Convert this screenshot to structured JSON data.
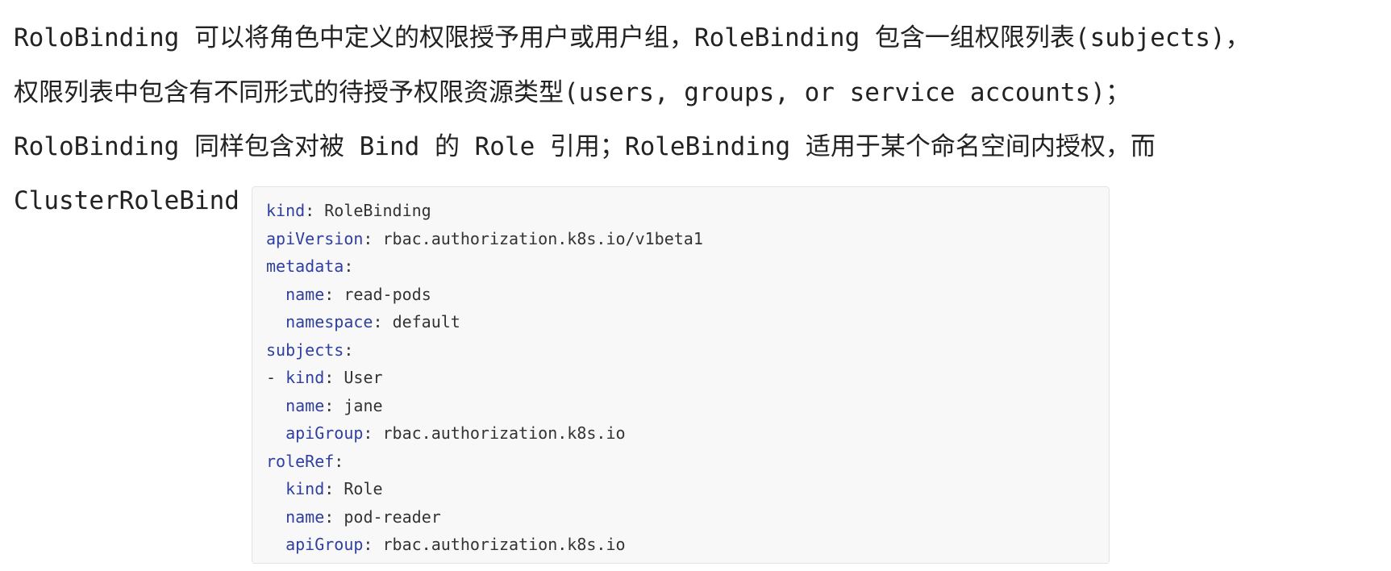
{
  "paragraph": {
    "line1": "RoloBinding 可以将角色中定义的权限授予用户或用户组，RoleBinding 包含一组权限列表(subjects)，",
    "line2": "权限列表中包含有不同形式的待授予权限资源类型(users, groups, or service accounts)；",
    "line3": "RoloBinding 同样包含对被 Bind 的 Role 引用；RoleBinding 适用于某个命名空间内授权，而",
    "line4": "ClusterRoleBind"
  },
  "code": {
    "lines": [
      {
        "indent": "",
        "prefix": "",
        "key": "kind",
        "sep": ": ",
        "value": "RoleBinding"
      },
      {
        "indent": "",
        "prefix": "",
        "key": "apiVersion",
        "sep": ": ",
        "value": "rbac.authorization.k8s.io/v1beta1"
      },
      {
        "indent": "",
        "prefix": "",
        "key": "metadata",
        "sep": ":",
        "value": ""
      },
      {
        "indent": "  ",
        "prefix": "",
        "key": "name",
        "sep": ": ",
        "value": "read-pods"
      },
      {
        "indent": "  ",
        "prefix": "",
        "key": "namespace",
        "sep": ": ",
        "value": "default"
      },
      {
        "indent": "",
        "prefix": "",
        "key": "subjects",
        "sep": ":",
        "value": ""
      },
      {
        "indent": "",
        "prefix": "- ",
        "key": "kind",
        "sep": ": ",
        "value": "User"
      },
      {
        "indent": "  ",
        "prefix": "",
        "key": "name",
        "sep": ": ",
        "value": "jane"
      },
      {
        "indent": "  ",
        "prefix": "",
        "key": "apiGroup",
        "sep": ": ",
        "value": "rbac.authorization.k8s.io"
      },
      {
        "indent": "",
        "prefix": "",
        "key": "roleRef",
        "sep": ":",
        "value": ""
      },
      {
        "indent": "  ",
        "prefix": "",
        "key": "kind",
        "sep": ": ",
        "value": "Role"
      },
      {
        "indent": "  ",
        "prefix": "",
        "key": "name",
        "sep": ": ",
        "value": "pod-reader"
      },
      {
        "indent": "  ",
        "prefix": "",
        "key": "apiGroup",
        "sep": ": ",
        "value": "rbac.authorization.k8s.io"
      }
    ]
  },
  "colors": {
    "code_key": "#2f3fa0",
    "code_value": "#333333",
    "code_background": "#f8f8f8"
  }
}
